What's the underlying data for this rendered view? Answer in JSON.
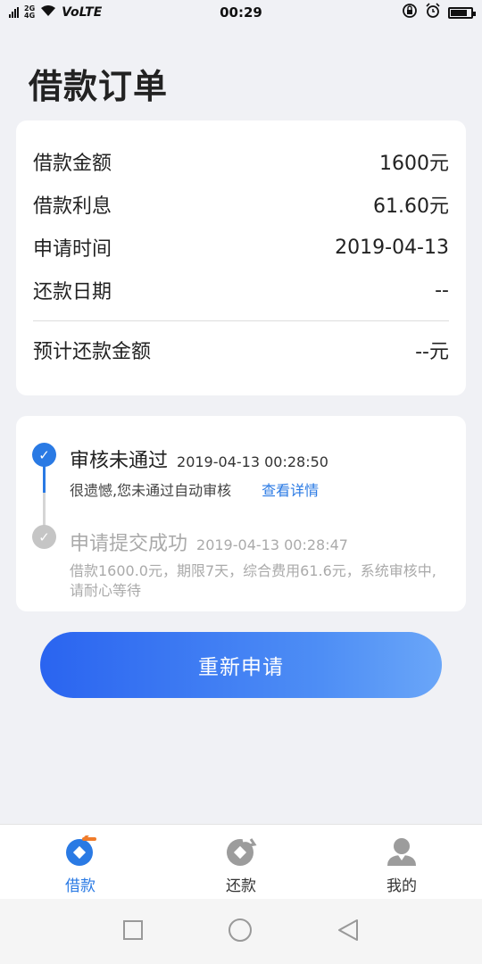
{
  "status_bar": {
    "network_top": "2G",
    "network_bottom": "4G",
    "volte": "VoLTE",
    "time": "00:29"
  },
  "page": {
    "title": "借款订单"
  },
  "summary": {
    "loan_amount_label": "借款金额",
    "loan_amount_value": "1600元",
    "interest_label": "借款利息",
    "interest_value": "61.60元",
    "apply_time_label": "申请时间",
    "apply_time_value": "2019-04-13",
    "repay_date_label": "还款日期",
    "repay_date_value": "--",
    "est_repay_label": "预计还款金额",
    "est_repay_value": "--元"
  },
  "timeline": [
    {
      "title": "审核未通过",
      "time": "2019-04-13 00:28:50",
      "desc": "很遗憾,您未通过自动审核",
      "link": "查看详情",
      "state": "active"
    },
    {
      "title": "申请提交成功",
      "time": "2019-04-13 00:28:47",
      "desc": "借款1600.0元，期限7天，综合费用61.6元，系统审核中,请耐心等待",
      "state": "done"
    }
  ],
  "actions": {
    "reapply_label": "重新申请"
  },
  "tabs": [
    {
      "label": "借款",
      "icon": "loan-icon",
      "active": true
    },
    {
      "label": "还款",
      "icon": "repay-icon",
      "active": false
    },
    {
      "label": "我的",
      "icon": "profile-icon",
      "active": false
    }
  ],
  "colors": {
    "accent": "#2a7ae4",
    "background": "#f0f1f5"
  }
}
